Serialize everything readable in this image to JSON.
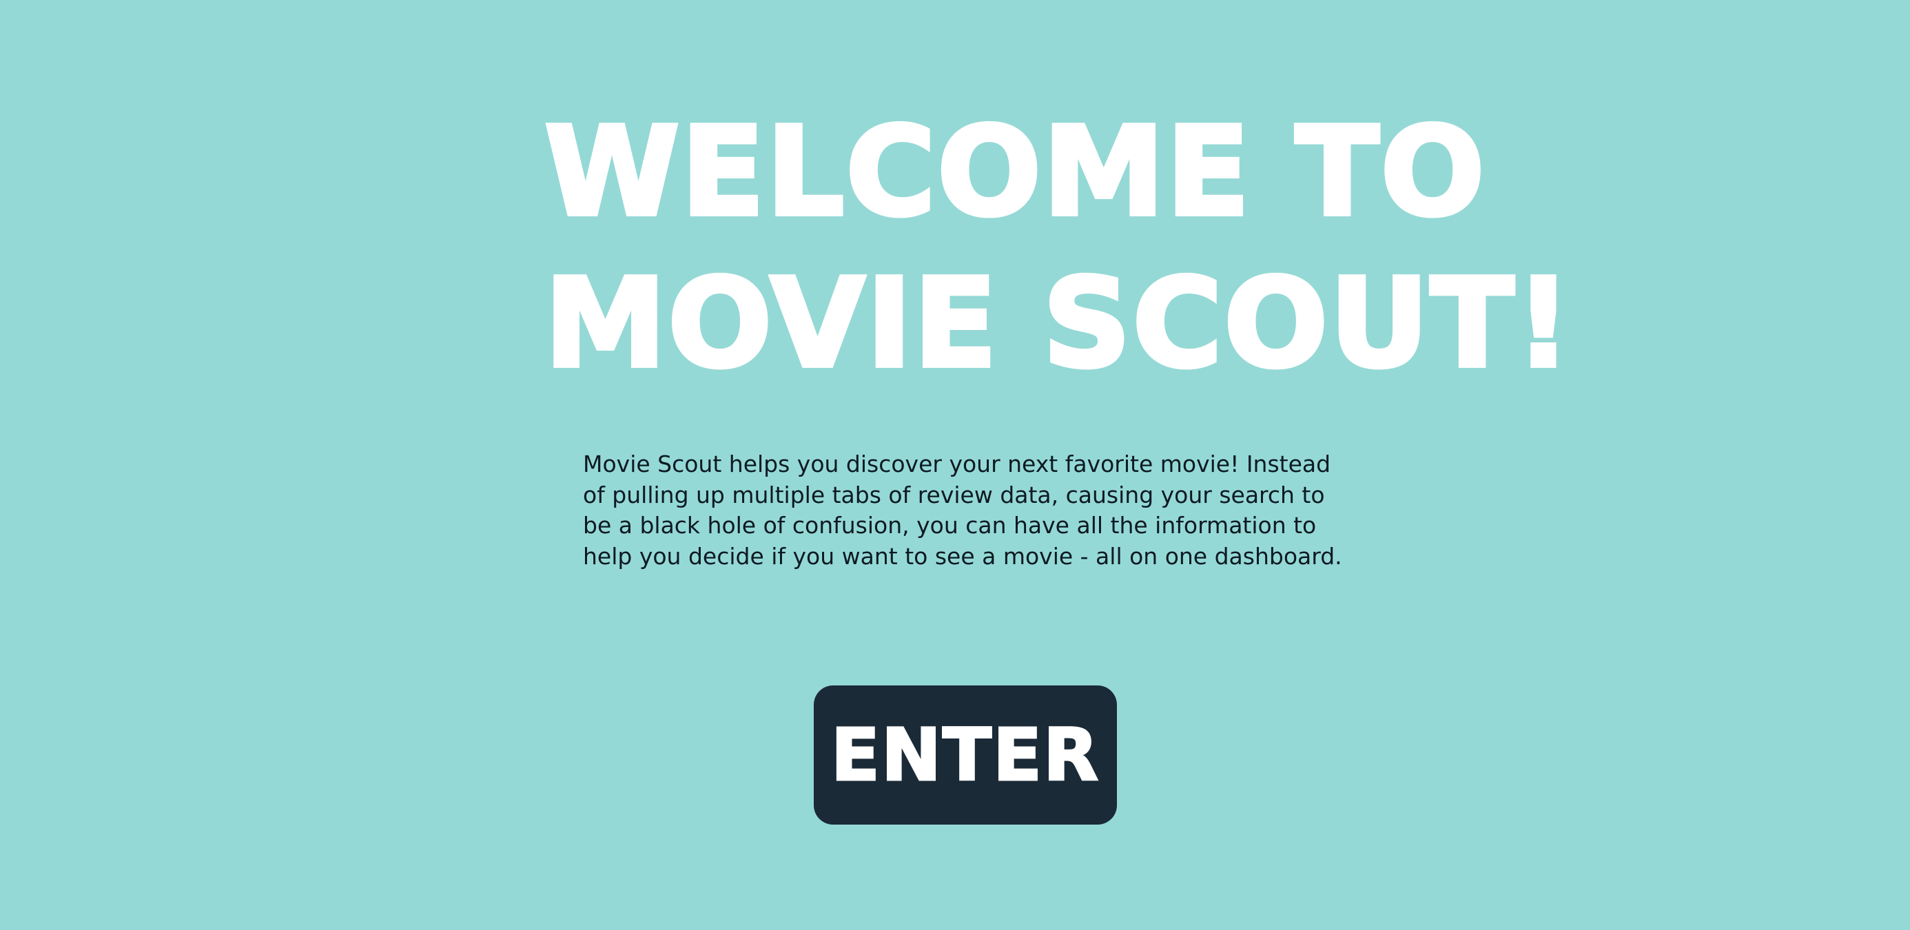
{
  "hero": {
    "title_line1": "WELCOME TO",
    "title_line2": "MOVIE SCOUT!"
  },
  "intro": {
    "description": "Movie Scout helps you discover your next favorite movie! Instead of pulling up multiple tabs of review data, causing your search to be a black hole of confusion, you can have all the information to help you decide if you want to see a movie - all on one dashboard."
  },
  "cta": {
    "enter_label": "ENTER"
  },
  "colors": {
    "background": "#95d9d6",
    "title": "#ffffff",
    "body_text": "#0d1a22",
    "button_bg": "#1b2a37",
    "button_text": "#ffffff"
  }
}
